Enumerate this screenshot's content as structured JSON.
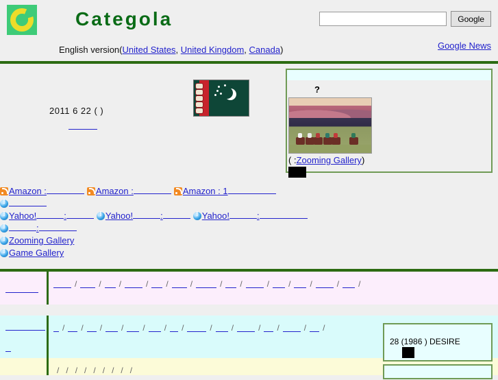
{
  "header": {
    "brand": "Categola",
    "logo_colors": {
      "square": "#3ecb78",
      "ring": "#ecdc2a",
      "center": "#3ecb78"
    },
    "search": {
      "value": "",
      "placeholder": "",
      "button_label": "Google"
    },
    "english_version_prefix": "English version(",
    "english_version_suffix": ")",
    "locales": [
      "United States",
      "United Kingdom",
      "Canada"
    ],
    "locale_separator": ", ",
    "google_news_label": "Google News",
    "rule_color": "#2c6b12"
  },
  "middle": {
    "date_text": "2011 6 22  ( )",
    "flag": {
      "name": "turkmenistan-flag",
      "field": "#0e4637",
      "stripe": "#c8232c"
    },
    "sub_link_label": ""
  },
  "panel": {
    "question_mark": "?",
    "painting_name": "racehorses-painting",
    "caption_open": "(  :",
    "caption_link": "Zooming Gallery",
    "caption_close": ")"
  },
  "feeds": {
    "rows": [
      [
        {
          "icon": "rss-icon",
          "label": "Amazon :",
          "blank": "u55"
        },
        {
          "icon": "rss-icon",
          "label": "Amazon :",
          "blank": "u55"
        },
        {
          "icon": "rss-icon",
          "label": "Amazon : 1",
          "blank": "u70"
        }
      ],
      [
        {
          "icon": "yahoo-icon",
          "label": "",
          "blank": "u55"
        }
      ],
      [
        {
          "icon": "yahoo-icon",
          "label": "Yahoo!",
          "mid": ":",
          "blank": "u55"
        },
        {
          "icon": "yahoo-icon",
          "label": "Yahoo!",
          "mid": ":",
          "blank": "u55"
        },
        {
          "icon": "yahoo-icon",
          "label": "Yahoo!",
          "mid": ":",
          "blank": "u70"
        }
      ],
      [
        {
          "icon": "yahoo-icon",
          "label": "",
          "mid": ":",
          "blank": "u90"
        }
      ],
      [
        {
          "icon": "yahoo-icon",
          "label": "Zooming Gallery",
          "blank": ""
        }
      ],
      [
        {
          "icon": "yahoo-icon",
          "label": "Game Gallery",
          "blank": ""
        }
      ]
    ]
  },
  "bands": [
    {
      "name": "pink",
      "bg": "#fceefc",
      "left_label": "",
      "items": 13,
      "separator": "/"
    },
    {
      "name": "cyan",
      "bg": "#d9fbfb",
      "left_label": "",
      "left_label2": "",
      "items": 13,
      "separator": "/"
    },
    {
      "name": "yellow",
      "bg": "#fcfbd8",
      "left_label": "",
      "items": 9,
      "separator": "/"
    }
  ],
  "right_boxes": [
    {
      "text": "28 (1986 )   DESIRE",
      "has_black_box": true
    },
    {
      "text": "",
      "has_black_box": false
    }
  ]
}
